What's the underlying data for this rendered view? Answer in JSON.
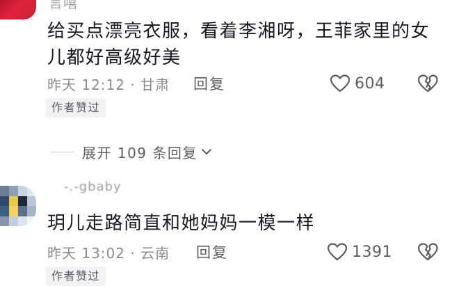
{
  "comments": [
    {
      "username": "言嘻",
      "text": "给买点漂亮衣服，看着李湘呀，王菲家里的女儿都好高级好美",
      "meta": "昨天 12:12 · 甘肃",
      "reply_label": "回复",
      "like_count": "604",
      "badge": "作者赞过"
    },
    {
      "username": "-.-gbaby",
      "text": "玥儿走路简直和她妈妈一模一样",
      "meta": "昨天 13:02 · 云南",
      "reply_label": "回复",
      "like_count": "1391",
      "badge": "作者赞过"
    }
  ],
  "expand_replies": {
    "label": "展开 109 条回复"
  },
  "colors": {
    "text_primary": "#161823",
    "text_secondary": "#8a8b91",
    "icon": "#5c5d63",
    "badge_bg": "#f2f2f4",
    "avatar_red": "#e0233d"
  },
  "icons": {
    "like": "heart-outline-icon",
    "dislike": "broken-heart-icon",
    "expand": "chevron-down-icon"
  }
}
